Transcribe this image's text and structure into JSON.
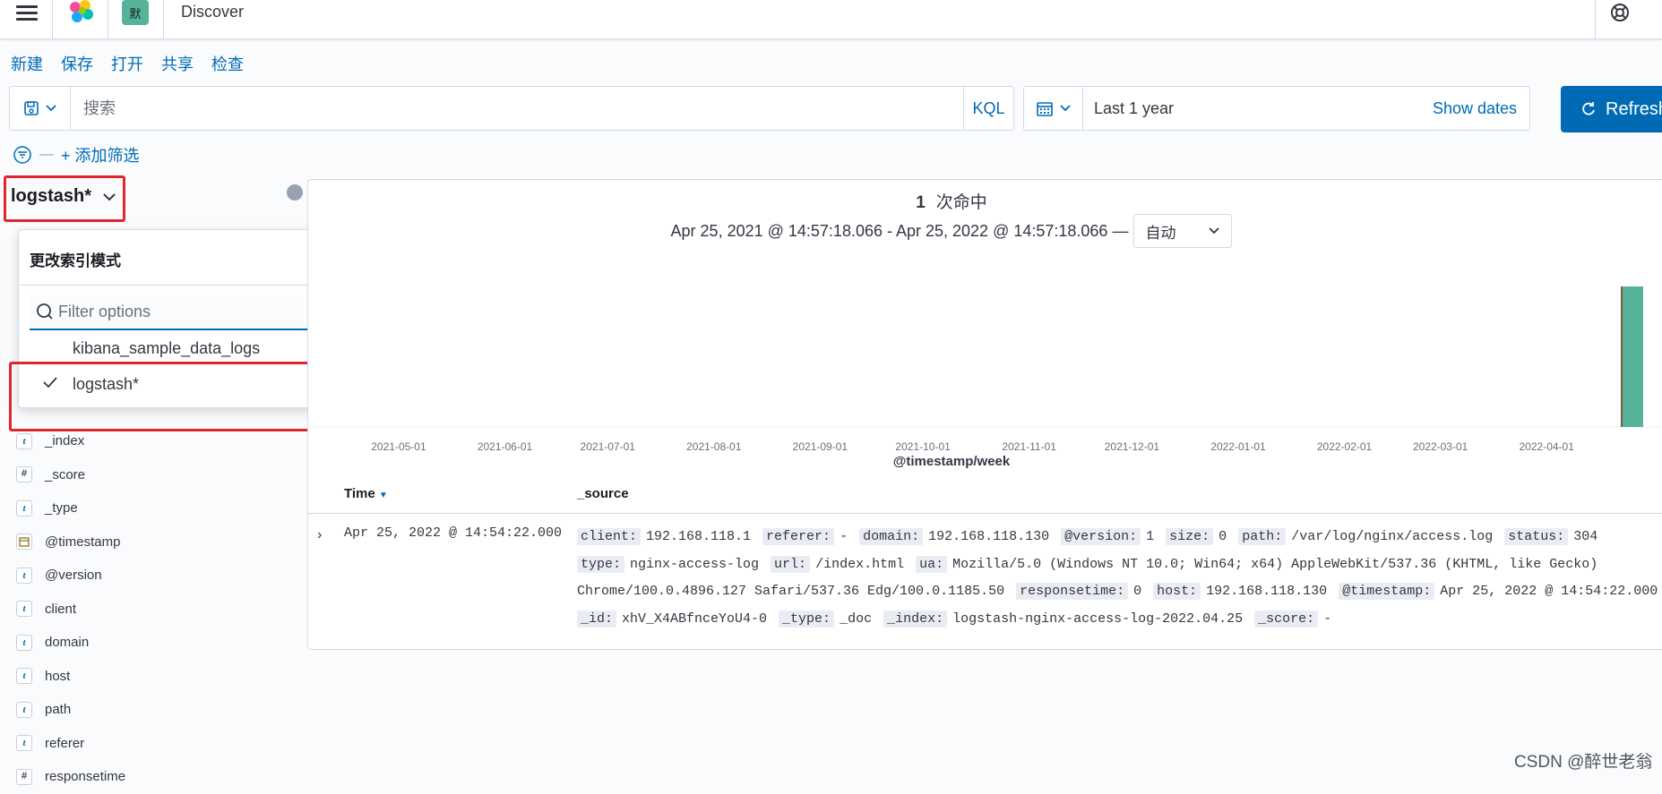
{
  "app": {
    "title": "Discover",
    "space_initial": "默"
  },
  "menu": [
    "新建",
    "保存",
    "打开",
    "共享",
    "检查"
  ],
  "search": {
    "placeholder": "搜索",
    "language": "KQL"
  },
  "date": {
    "range": "Last 1 year",
    "show_dates": "Show dates"
  },
  "refresh": {
    "label": "Refresh"
  },
  "filter": {
    "add_label": "+ 添加筛选"
  },
  "index_pattern": {
    "selected": "logstash*"
  },
  "popover": {
    "title": "更改索引模式",
    "filter_placeholder": "Filter options",
    "options": [
      "kibana_sample_data_logs",
      "logstash*"
    ],
    "checked_option": "logstash*"
  },
  "fields": [
    {
      "type": "t",
      "name": "_index"
    },
    {
      "type": "#",
      "name": "_score"
    },
    {
      "type": "t",
      "name": "_type"
    },
    {
      "type": "date",
      "name": "@timestamp"
    },
    {
      "type": "t",
      "name": "@version"
    },
    {
      "type": "t",
      "name": "client"
    },
    {
      "type": "t",
      "name": "domain"
    },
    {
      "type": "t",
      "name": "host"
    },
    {
      "type": "t",
      "name": "path"
    },
    {
      "type": "t",
      "name": "referer"
    },
    {
      "type": "#",
      "name": "responsetime"
    }
  ],
  "histogram": {
    "hits_count": "1",
    "hits_label": "次命中",
    "time_range": "Apr 25, 2021 @ 14:57:18.066 - Apr 25, 2022 @ 14:57:18.066 —",
    "interval": "自动",
    "xlabel": "@timestamp/week",
    "ticks": [
      "2021-05-01",
      "2021-06-01",
      "2021-07-01",
      "2021-08-01",
      "2021-09-01",
      "2021-10-01",
      "2021-11-01",
      "2021-12-01",
      "2022-01-01",
      "2022-02-01",
      "2022-03-01",
      "2022-04-01"
    ],
    "bar_color": "#54b399"
  },
  "chart_data": {
    "type": "bar",
    "title": "",
    "xlabel": "@timestamp/week",
    "ylabel": "",
    "categories": [
      "2022-04-25"
    ],
    "values": [
      1
    ],
    "x_ticks": [
      "2021-05-01",
      "2021-06-01",
      "2021-07-01",
      "2021-08-01",
      "2021-09-01",
      "2021-10-01",
      "2021-11-01",
      "2021-12-01",
      "2022-01-01",
      "2022-02-01",
      "2022-03-01",
      "2022-04-01"
    ]
  },
  "table": {
    "headers": {
      "time": "Time",
      "source": "_source"
    },
    "rows": [
      {
        "time": "Apr 25, 2022 @ 14:54:22.000",
        "source": [
          {
            "k": "client:",
            "v": "192.168.118.1"
          },
          {
            "k": "referer:",
            "v": "-"
          },
          {
            "k": "domain:",
            "v": "192.168.118.130"
          },
          {
            "k": "@version:",
            "v": "1"
          },
          {
            "k": "size:",
            "v": "0"
          },
          {
            "k": "path:",
            "v": "/var/log/nginx/access.log"
          },
          {
            "k": "status:",
            "v": "304"
          },
          {
            "k": "type:",
            "v": "nginx-access-log"
          },
          {
            "k": "url:",
            "v": "/index.html"
          },
          {
            "k": "ua:",
            "v": "Mozilla/5.0 (Windows NT 10.0; Win64; x64) AppleWebKit/537.36 (KHTML, like Gecko) Chrome/100.0.4896.127 Safari/537.36 Edg/100.0.1185.50"
          },
          {
            "k": "responsetime:",
            "v": "0"
          },
          {
            "k": "host:",
            "v": "192.168.118.130"
          },
          {
            "k": "@timestamp:",
            "v": "Apr 25, 2022 @ 14:54:22.000"
          },
          {
            "k": "_id:",
            "v": "xhV_X4ABfnceYoU4-0"
          },
          {
            "k": "_type:",
            "v": "_doc"
          },
          {
            "k": "_index:",
            "v": "logstash-nginx-access-log-2022.04.25"
          },
          {
            "k": "_score:",
            "v": "-"
          }
        ]
      }
    ]
  },
  "watermark": "CSDN @醉世老翁"
}
